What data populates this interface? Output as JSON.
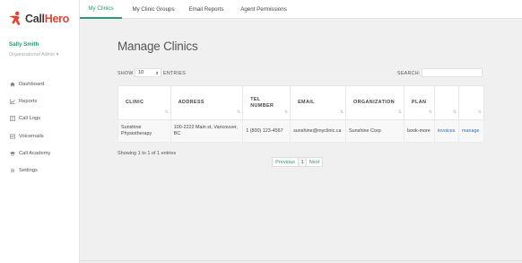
{
  "brand": {
    "name_part1": "Call",
    "name_part2": "Hero"
  },
  "user": {
    "name": "Sally Smith",
    "role": "Organizational Admin ▾"
  },
  "sidebar": {
    "items": [
      {
        "label": "Dashboard",
        "icon": "home-icon"
      },
      {
        "label": "Reports",
        "icon": "chart-icon"
      },
      {
        "label": "Call Logs",
        "icon": "phone-log-icon"
      },
      {
        "label": "Voicemails",
        "icon": "voicemail-icon"
      },
      {
        "label": "Call Academy",
        "icon": "graduation-cap-icon"
      },
      {
        "label": "Settings",
        "icon": "gear-icon"
      }
    ]
  },
  "tabs": [
    {
      "label": "My Clinics",
      "active": true
    },
    {
      "label": "My Clinic Groups",
      "active": false
    },
    {
      "label": "Email Reports",
      "active": false
    },
    {
      "label": "Agent Permissions",
      "active": false
    }
  ],
  "page": {
    "title": "Manage Clinics",
    "show_label": "SHOW",
    "show_value": "10",
    "entries_label": "ENTRIES",
    "search_label": "SEARCH:",
    "search_value": ""
  },
  "table": {
    "headers": [
      "CLINIC",
      "ADDRESS",
      "TEL NUMBER",
      "EMAIL",
      "ORGANIZATION",
      "PLAN",
      "",
      ""
    ],
    "rows": [
      {
        "clinic": "Sunshine Physiotherapy",
        "address": "100-2222 Main st, Vancouver, BC",
        "tel": "1 (800) 123-4567",
        "email": "sunshine@myclinic.ca",
        "organization": "Sunshine Corp",
        "plan": "book-more",
        "invoices": "invoices",
        "manage": "manage"
      }
    ]
  },
  "footer": {
    "showing": "Showing 1 to 1 of 1 entries",
    "prev": "Previous",
    "page": "1",
    "next": "Next"
  },
  "colors": {
    "accent": "#2a9d6e",
    "brand_red": "#e5442f",
    "link": "#2e6eb3"
  }
}
